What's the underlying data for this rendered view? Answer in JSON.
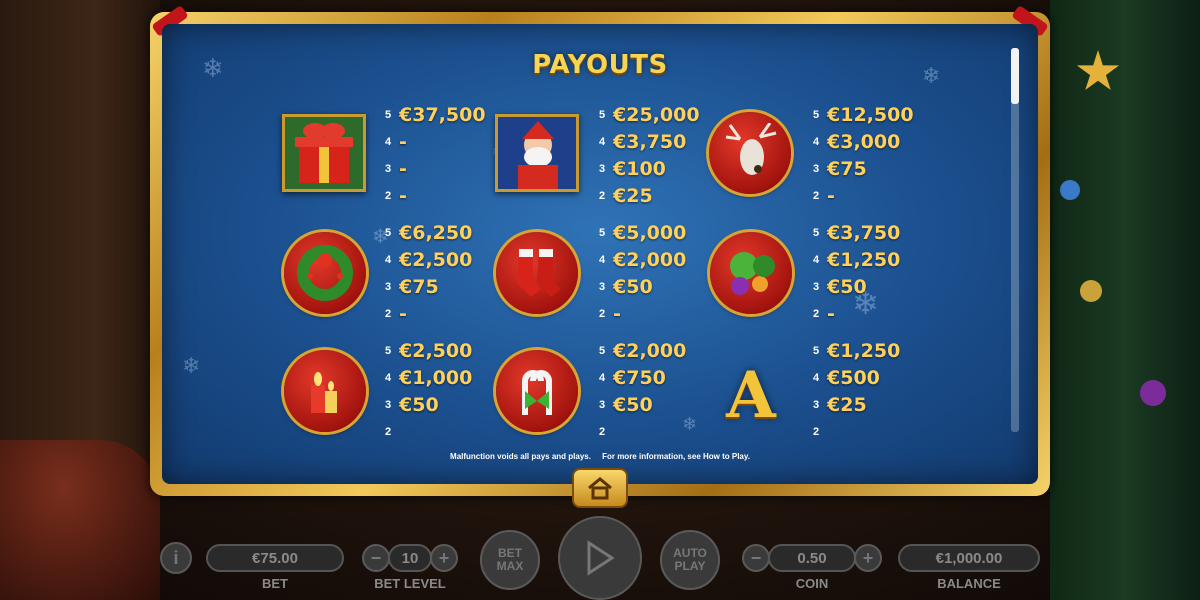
{
  "payouts": {
    "title": "PAYOUTS",
    "footer_left": "Malfunction voids all pays and plays.",
    "footer_right": "For more information, see How to Play.",
    "symbols": [
      {
        "name": "gift-box",
        "rows": [
          {
            "n": "5",
            "v": "€37,500"
          },
          {
            "n": "4",
            "v": "-"
          },
          {
            "n": "3",
            "v": "-"
          },
          {
            "n": "2",
            "v": "-"
          }
        ]
      },
      {
        "name": "santa",
        "rows": [
          {
            "n": "5",
            "v": "€25,000"
          },
          {
            "n": "4",
            "v": "€3,750"
          },
          {
            "n": "3",
            "v": "€100"
          },
          {
            "n": "2",
            "v": "€25"
          }
        ]
      },
      {
        "name": "reindeer",
        "rows": [
          {
            "n": "5",
            "v": "€12,500"
          },
          {
            "n": "4",
            "v": "€3,000"
          },
          {
            "n": "3",
            "v": "€75"
          },
          {
            "n": "2",
            "v": "-"
          }
        ]
      },
      {
        "name": "wreath",
        "rows": [
          {
            "n": "5",
            "v": "€6,250"
          },
          {
            "n": "4",
            "v": "€2,500"
          },
          {
            "n": "3",
            "v": "€75"
          },
          {
            "n": "2",
            "v": "-"
          }
        ]
      },
      {
        "name": "stockings",
        "rows": [
          {
            "n": "5",
            "v": "€5,000"
          },
          {
            "n": "4",
            "v": "€2,000"
          },
          {
            "n": "3",
            "v": "€50"
          },
          {
            "n": "2",
            "v": "-"
          }
        ]
      },
      {
        "name": "ornaments",
        "rows": [
          {
            "n": "5",
            "v": "€3,750"
          },
          {
            "n": "4",
            "v": "€1,250"
          },
          {
            "n": "3",
            "v": "€50"
          },
          {
            "n": "2",
            "v": "-"
          }
        ]
      },
      {
        "name": "candles",
        "rows": [
          {
            "n": "5",
            "v": "€2,500"
          },
          {
            "n": "4",
            "v": "€1,000"
          },
          {
            "n": "3",
            "v": "€50"
          },
          {
            "n": "2",
            "v": ""
          }
        ]
      },
      {
        "name": "candy-canes",
        "rows": [
          {
            "n": "5",
            "v": "€2,000"
          },
          {
            "n": "4",
            "v": "€750"
          },
          {
            "n": "3",
            "v": "€50"
          },
          {
            "n": "2",
            "v": ""
          }
        ]
      },
      {
        "name": "letter-a",
        "letter": "A",
        "rows": [
          {
            "n": "5",
            "v": "€1,250"
          },
          {
            "n": "4",
            "v": "€500"
          },
          {
            "n": "3",
            "v": "€25"
          },
          {
            "n": "2",
            "v": ""
          }
        ]
      }
    ]
  },
  "controls": {
    "info": "i",
    "bet_value": "€75.00",
    "bet_label": "BET",
    "bet_level_value": "10",
    "bet_level_label": "BET LEVEL",
    "bet_max_1": "BET",
    "bet_max_2": "MAX",
    "auto_play_1": "AUTO",
    "auto_play_2": "PLAY",
    "coin_value": "0.50",
    "coin_label": "COIN",
    "balance_value": "€1,000.00",
    "balance_label": "BALANCE",
    "minus": "−",
    "plus": "+"
  },
  "colors": {
    "gold": "#f7d453",
    "panel_blue": "#1b4f8e",
    "frame_gold": "#d9a432",
    "ribbon_red": "#c2141b"
  }
}
